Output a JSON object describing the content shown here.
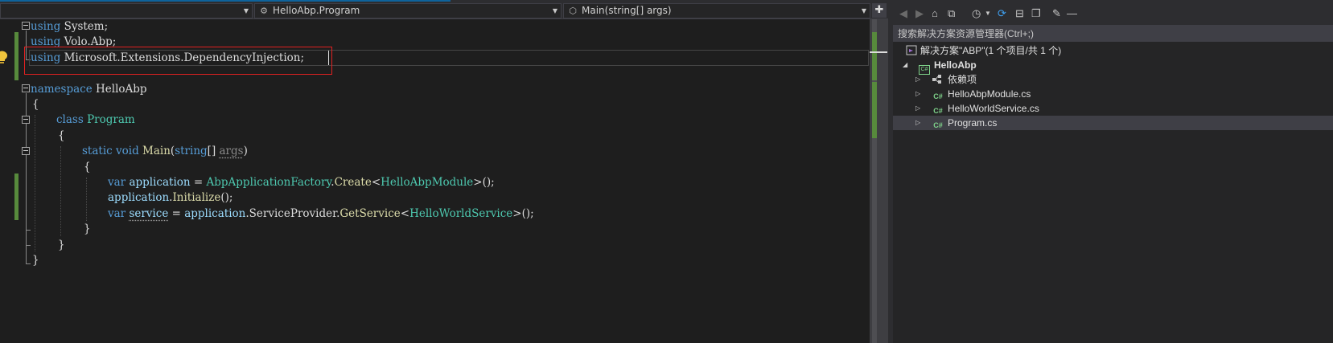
{
  "navbar": {
    "project_dropdown": "",
    "class_dropdown": "HelloAbp.Program",
    "member_dropdown": "Main(string[] args)"
  },
  "code": {
    "l1_kw": "using",
    "l1_rest": " System;",
    "l2_kw": "using",
    "l2_rest": " Volo.Abp;",
    "l3_kw": "using",
    "l3_rest": " Microsoft.Extensions.DependencyInjection;",
    "l5_kw": "namespace",
    "l5_name": " HelloAbp",
    "l6": "{",
    "l7_kw": "class",
    "l7_name": "Program",
    "l8": "{",
    "l9_kw1": "static",
    "l9_kw2": "void",
    "l9_fn": "Main",
    "l9_open": "(",
    "l9_kw3": "string",
    "l9_br": "[] ",
    "l9_arg": "args",
    "l9_close": ")",
    "l10": "{",
    "l11_kw": "var",
    "l11_var": "application",
    "l11_eq": " = ",
    "l11_type": "AbpApplicationFactory",
    "l11_dot": ".",
    "l11_fn": "Create",
    "l11_lt": "<",
    "l11_gen": "HelloAbpModule",
    "l11_end": ">();",
    "l12_var": "application",
    "l12_dot": ".",
    "l12_fn": "Initialize",
    "l12_end": "();",
    "l13_kw": "var",
    "l13_var": "service",
    "l13_eq": " = ",
    "l13_obj": "application",
    "l13_dot1": ".",
    "l13_prop": "ServiceProvider",
    "l13_dot2": ".",
    "l13_fn": "GetService",
    "l13_lt": "<",
    "l13_gen": "HelloWorldService",
    "l13_end": ">();",
    "l14": "}",
    "l15": "}",
    "l16": "}"
  },
  "solution_explorer": {
    "search_placeholder": "搜索解决方案资源管理器(Ctrl+;)",
    "solution_label": "解决方案\"ABP\"(1 个项目/共 1 个)",
    "project_label": "HelloAbp",
    "items": [
      {
        "label": "依赖项",
        "icon": "dependencies-icon"
      },
      {
        "label": "HelloAbpModule.cs",
        "icon": "csharp-file-icon"
      },
      {
        "label": "HelloWorldService.cs",
        "icon": "csharp-file-icon"
      },
      {
        "label": "Program.cs",
        "icon": "csharp-file-icon"
      }
    ],
    "cs_badge": "C#",
    "proj_badge": "C#"
  },
  "colors": {
    "keyword": "#569cd6",
    "type": "#4ec9b0",
    "method": "#dcdcaa",
    "identifier": "#9cdcfe",
    "change_marker": "#578a3c",
    "highlight_box": "#e02121"
  }
}
